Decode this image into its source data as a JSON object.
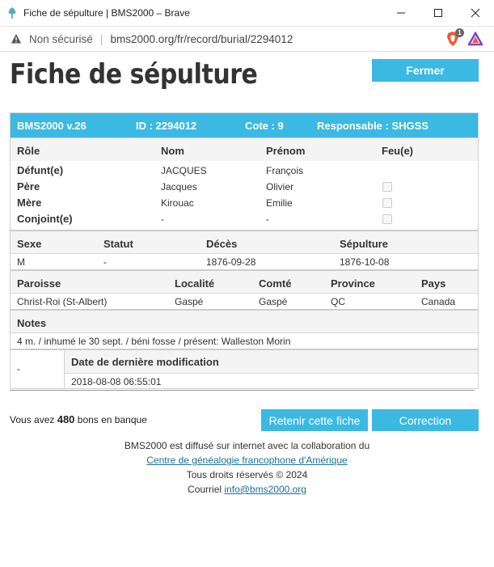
{
  "window": {
    "title": "Fiche de sépulture | BMS2000 – Brave",
    "not_secure": "Non sécurisé",
    "separator": "|",
    "url": "bms2000.org/fr/record/burial/2294012",
    "brave_badge": "1",
    "minimize": "—",
    "maximize": "☐",
    "close": "✕"
  },
  "page": {
    "title": "Fiche de sépulture",
    "close_button": "Fermer"
  },
  "record": {
    "version": "BMS2000 v.26",
    "id": "ID : 2294012",
    "cote": "Cote : 9",
    "responsable": "Responsable : SHGSS",
    "persons_headers": [
      "Rôle",
      "Nom",
      "Prénom",
      "Feu(e)"
    ],
    "persons": [
      {
        "role": "Défunt(e)",
        "nom": "JACQUES",
        "prenom": "François",
        "feu": null
      },
      {
        "role": "Père",
        "nom": "Jacques",
        "prenom": "Olivier",
        "feu": false
      },
      {
        "role": "Mère",
        "nom": "Kirouac",
        "prenom": "Emilie",
        "feu": false
      },
      {
        "role": "Conjoint(e)",
        "nom": "-",
        "prenom": "-",
        "feu": false
      }
    ],
    "vital_headers": [
      "Sexe",
      "Statut",
      "Décès",
      "Sépulture"
    ],
    "vital": {
      "sexe": "M",
      "statut": "-",
      "deces": "1876-09-28",
      "sepulture": "1876-10-08"
    },
    "place_headers": [
      "Paroisse",
      "Localité",
      "Comté",
      "Province",
      "Pays"
    ],
    "place": {
      "paroisse": "Christ-Roi (St-Albert)",
      "localite": "Gaspé",
      "comte": "Gaspé",
      "province": "QC",
      "pays": "Canada"
    },
    "notes_header": "Notes",
    "notes": "4 m. / inhumé le 30 sept. / béni fosse / présent: Walleston Morin",
    "modif_left": "-",
    "modif_header": "Date de dernière modification",
    "modif_date": "2018-08-08 06:55:01"
  },
  "actions": {
    "credits_prefix": "Vous avez",
    "credits_amount": "480",
    "credits_suffix": "bons en banque",
    "retenir": "Retenir cette fiche",
    "correction": "Correction"
  },
  "footer": {
    "line1": "BMS2000 est diffusé sur internet avec la collaboration du",
    "link1": "Centre de généalogie francophone d'Amérique",
    "line3": "Tous droits réservés © 2024",
    "line4_prefix": "Courriel",
    "email": "info@bms2000.org"
  },
  "colors": {
    "accent": "#3bb9e3",
    "link": "#1a6f9a"
  }
}
